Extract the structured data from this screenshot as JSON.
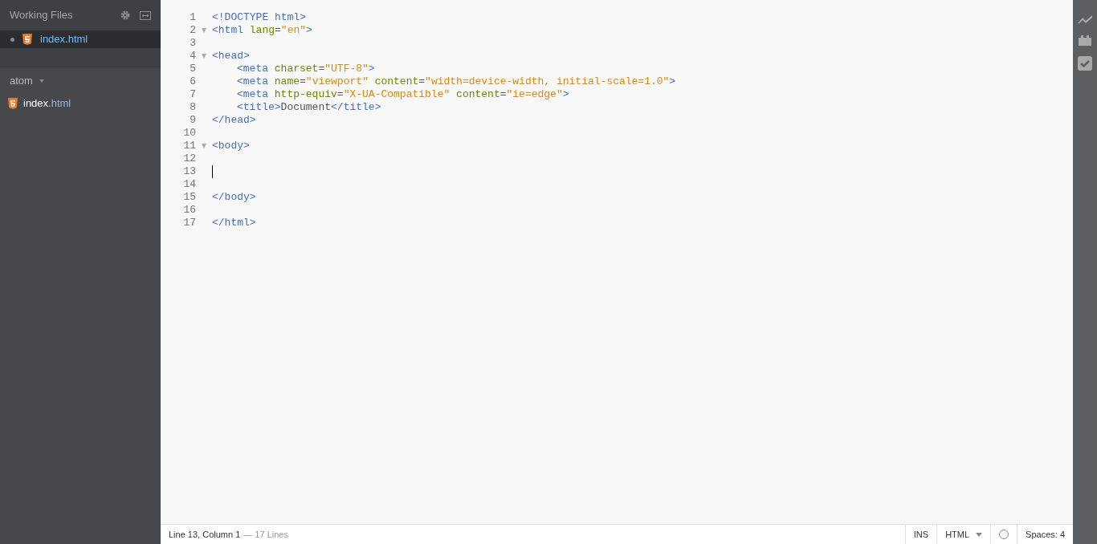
{
  "sidebar": {
    "working_files": {
      "title": "Working Files",
      "files": [
        {
          "name": "index.html",
          "selected": true,
          "dirty": true
        }
      ]
    },
    "project": {
      "name": "atom",
      "files": [
        {
          "name": "index",
          "extension": ".html"
        }
      ]
    }
  },
  "editor": {
    "lines": [
      {
        "number": "1",
        "foldable": false,
        "cursor": false,
        "tokens": [
          {
            "kind": "tag",
            "text": "<!DOCTYPE html>"
          }
        ]
      },
      {
        "number": "2",
        "foldable": true,
        "cursor": false,
        "tokens": [
          {
            "kind": "tag",
            "text": "<html"
          },
          {
            "kind": "attr",
            "text": " lang"
          },
          {
            "kind": "plain",
            "text": "="
          },
          {
            "kind": "string",
            "text": "\"en\""
          },
          {
            "kind": "tag",
            "text": ">"
          }
        ]
      },
      {
        "number": "3",
        "foldable": false,
        "cursor": false
      },
      {
        "number": "4",
        "foldable": true,
        "cursor": false,
        "tokens": [
          {
            "kind": "tag",
            "text": "<head>"
          }
        ]
      },
      {
        "number": "5",
        "foldable": false,
        "cursor": false,
        "indented": true,
        "tokens": [
          {
            "kind": "tag",
            "text": "<meta"
          },
          {
            "kind": "attr",
            "text": " charset"
          },
          {
            "kind": "plain",
            "text": "="
          },
          {
            "kind": "string",
            "text": "\"UTF-8\""
          },
          {
            "kind": "tag",
            "text": ">"
          }
        ]
      },
      {
        "number": "6",
        "foldable": false,
        "cursor": false,
        "indented": true,
        "tokens": [
          {
            "kind": "tag",
            "text": "<meta"
          },
          {
            "kind": "attr",
            "text": " name"
          },
          {
            "kind": "plain",
            "text": "="
          },
          {
            "kind": "string",
            "text": "\"viewport\""
          },
          {
            "kind": "attr",
            "text": " content"
          },
          {
            "kind": "plain",
            "text": "="
          },
          {
            "kind": "string",
            "text": "\"width=device-width, initial-scale=1.0\""
          },
          {
            "kind": "tag",
            "text": ">"
          }
        ]
      },
      {
        "number": "7",
        "foldable": false,
        "cursor": false,
        "indented": true,
        "tokens": [
          {
            "kind": "tag",
            "text": "<meta"
          },
          {
            "kind": "attr",
            "text": " http-equiv"
          },
          {
            "kind": "plain",
            "text": "="
          },
          {
            "kind": "string",
            "text": "\"X-UA-Compatible\""
          },
          {
            "kind": "attr",
            "text": " content"
          },
          {
            "kind": "plain",
            "text": "="
          },
          {
            "kind": "string",
            "text": "\"ie=edge\""
          },
          {
            "kind": "tag",
            "text": ">"
          }
        ]
      },
      {
        "number": "8",
        "foldable": false,
        "cursor": false,
        "indented": true,
        "tokens": [
          {
            "kind": "tag",
            "text": "<title>"
          },
          {
            "kind": "plain",
            "text": "Document"
          },
          {
            "kind": "tag",
            "text": "</title>"
          }
        ]
      },
      {
        "number": "9",
        "foldable": false,
        "cursor": false,
        "tokens": [
          {
            "kind": "tag",
            "text": "</head>"
          }
        ]
      },
      {
        "number": "10",
        "foldable": false,
        "cursor": false
      },
      {
        "number": "11",
        "foldable": true,
        "cursor": false,
        "tokens": [
          {
            "kind": "tag",
            "text": "<body>"
          }
        ]
      },
      {
        "number": "12",
        "foldable": false,
        "cursor": false
      },
      {
        "number": "13",
        "foldable": false,
        "cursor": true
      },
      {
        "number": "14",
        "foldable": false,
        "cursor": false
      },
      {
        "number": "15",
        "foldable": false,
        "cursor": false,
        "tokens": [
          {
            "kind": "tag",
            "text": "</body>"
          }
        ]
      },
      {
        "number": "16",
        "foldable": false,
        "cursor": false
      },
      {
        "number": "17",
        "foldable": false,
        "cursor": false,
        "tokens": [
          {
            "kind": "tag",
            "text": "</html>"
          }
        ]
      }
    ]
  },
  "status_bar": {
    "position": "Line 13, Column 1",
    "line_count": "— 17 Lines",
    "mode": "INS",
    "language": "HTML",
    "indent": "Spaces: 4"
  }
}
